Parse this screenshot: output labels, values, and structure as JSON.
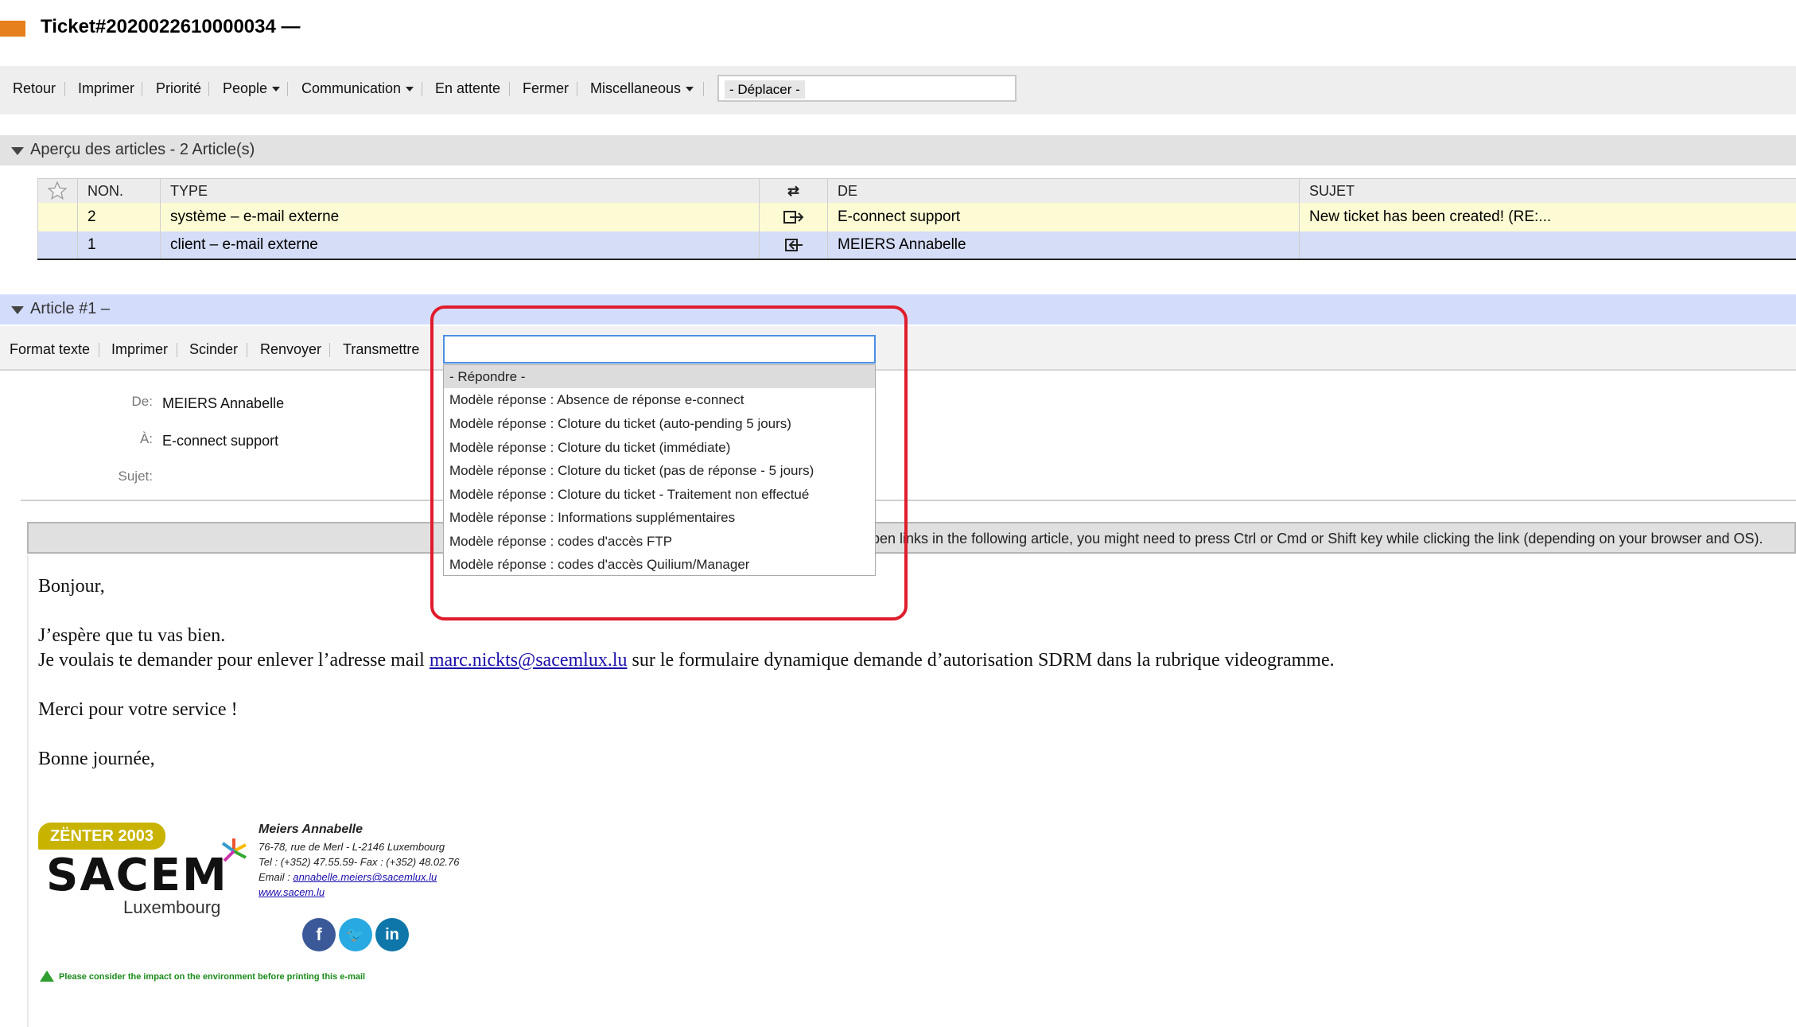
{
  "ticket": {
    "title": "Ticket#2020022610000034 —"
  },
  "toolbar": {
    "items": [
      "Retour",
      "Imprimer",
      "Priorité",
      "People",
      "Communication",
      "En attente",
      "Fermer",
      "Miscellaneous"
    ],
    "move_value": "- Déplacer -"
  },
  "articles_overview": {
    "label": "Aperçu des articles - 2 Article(s)",
    "columns": [
      "NON.",
      "TYPE",
      "⇄",
      "DE",
      "SUJET"
    ],
    "rows": [
      {
        "no": "2",
        "type": "système – e-mail externe",
        "direction_icon": "outgoing-icon",
        "from": "E-connect support",
        "subject": "New ticket has been created! (RE:..."
      },
      {
        "no": "1",
        "type": "client – e-mail externe",
        "direction_icon": "incoming-icon",
        "from": "MEIERS Annabelle",
        "subject": ""
      }
    ]
  },
  "article": {
    "label": "Article #1 –",
    "tools": [
      "Format texte",
      "Imprimer",
      "Scinder",
      "Renvoyer",
      "Transmettre"
    ],
    "from_label": "De:",
    "from_value": "MEIERS Annabelle",
    "to_label": "À:",
    "to_value": "E-connect support",
    "subject_label": "Sujet:",
    "notice": "open links in the following article, you might need to press Ctrl or Cmd or Shift key while clicking the link (depending on your browser and OS).",
    "body": {
      "greeting": "Bonjour,",
      "line1": "J’espère que tu vas bien.",
      "line2_before": "Je voulais te demander pour enlever l’adresse mail ",
      "line2_link": "marc.nickts@sacemlux.lu",
      "line2_after": " sur le formulaire dynamique demande d’autorisation SDRM dans la rubrique videogramme.",
      "line3": "Merci pour votre service !",
      "line4": "Bonne journée,"
    }
  },
  "reply_dropdown": {
    "search_value": "",
    "options": [
      "- Répondre -",
      "Modèle réponse : Absence de réponse e-connect",
      "Modèle réponse : Cloture du ticket (auto-pending 5 jours)",
      "Modèle réponse : Cloture du ticket (immédiate)",
      "Modèle réponse : Cloture du ticket (pas de réponse - 5 jours)",
      "Modèle réponse : Cloture du ticket - Traitement non effectué",
      "Modèle réponse : Informations supplémentaires",
      "Modèle réponse : codes d'accès FTP",
      "Modèle réponse : codes d'accès Quilium/Manager"
    ],
    "highlight_color": "#e01c2c"
  },
  "signature": {
    "badge": "ZËNTER 2003",
    "logo_word": "SACEM",
    "logo_sub": "Luxembourg",
    "name": "Meiers Annabelle",
    "address": "76-78, rue de Merl - L-2146 Luxembourg",
    "phone": "Tel : (+352) 47.55.59- Fax : (+352) 48.02.76",
    "email_label": "Email : ",
    "email": "annabelle.meiers@sacemlux.lu",
    "website": "www.sacem.lu",
    "eco_note": "Please consider the impact on the environment before printing this e-mail"
  }
}
